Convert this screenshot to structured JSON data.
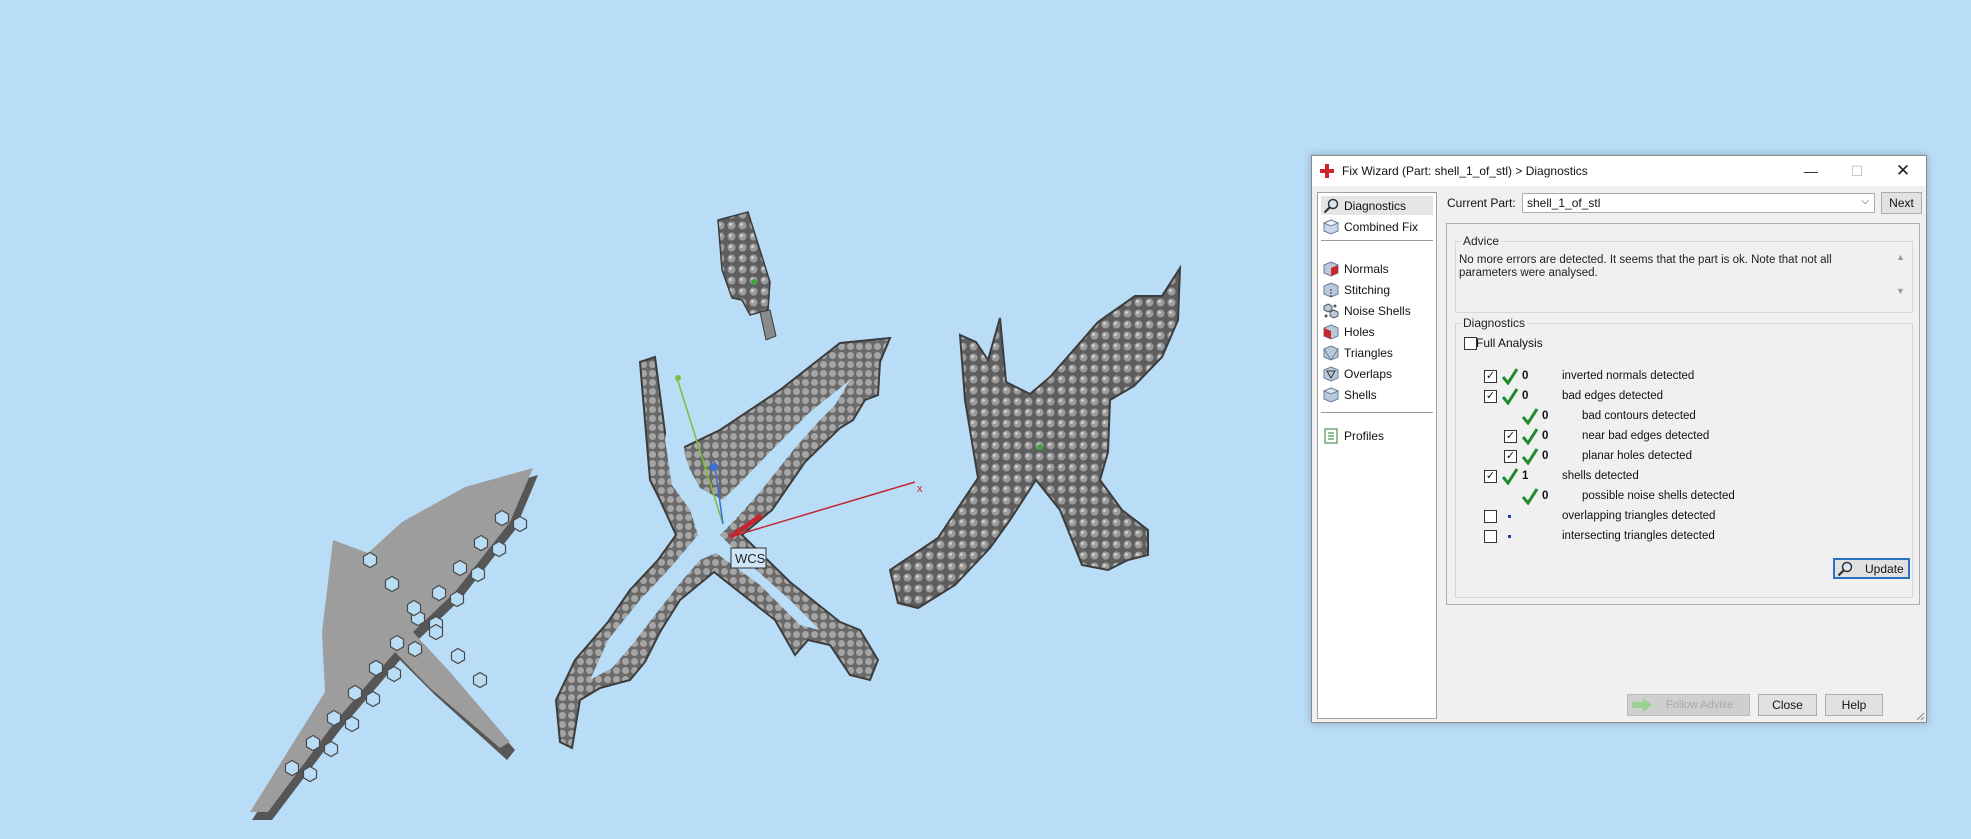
{
  "viewport": {
    "background": "#b9ddf7",
    "wcs_label": "WCS",
    "x_axis_label": "x"
  },
  "dialog": {
    "title": "Fix Wizard (Part: shell_1_of_stl) > Diagnostics",
    "title_icon": "red-cross-icon",
    "window_controls": {
      "minimize": "—",
      "maximize": "☐",
      "close": "✕"
    },
    "sidebar": {
      "top_items": [
        {
          "label": "Diagnostics",
          "icon": "magnifier-icon",
          "active": true
        },
        {
          "label": "Combined Fix",
          "icon": "cube-icon",
          "active": false
        }
      ],
      "fix_items": [
        {
          "label": "Normals",
          "icon": "normals-cube-icon"
        },
        {
          "label": "Stitching",
          "icon": "stitching-cube-icon"
        },
        {
          "label": "Noise Shells",
          "icon": "noise-shells-icon"
        },
        {
          "label": "Holes",
          "icon": "holes-cube-icon"
        },
        {
          "label": "Triangles",
          "icon": "triangles-cube-icon"
        },
        {
          "label": "Overlaps",
          "icon": "overlaps-cube-icon"
        },
        {
          "label": "Shells",
          "icon": "shells-cube-icon"
        }
      ],
      "bottom_items": [
        {
          "label": "Profiles",
          "icon": "profiles-document-icon"
        }
      ]
    },
    "current_part": {
      "label": "Current Part:",
      "value": "shell_1_of_stl",
      "next_label": "Next"
    },
    "advice": {
      "title": "Advice",
      "text": "No more errors are detected. It seems that the part is ok. Note that not all parameters were analysed."
    },
    "diagnostics": {
      "title": "Diagnostics",
      "full_analysis_label": "Full Analysis",
      "full_analysis_checked": false,
      "rows": [
        {
          "checkbox": true,
          "checked": true,
          "status": "ok",
          "count": "0",
          "desc": "inverted normals detected",
          "indent": 0
        },
        {
          "checkbox": true,
          "checked": true,
          "status": "ok",
          "count": "0",
          "desc": "bad edges detected",
          "indent": 0
        },
        {
          "checkbox": false,
          "checked": false,
          "status": "ok",
          "count": "0",
          "desc": "bad contours detected",
          "indent": 1
        },
        {
          "checkbox": true,
          "checked": true,
          "status": "ok",
          "count": "0",
          "desc": "near bad edges detected",
          "indent": 1
        },
        {
          "checkbox": true,
          "checked": true,
          "status": "ok",
          "count": "0",
          "desc": "planar holes detected",
          "indent": 1
        },
        {
          "checkbox": true,
          "checked": true,
          "status": "ok",
          "count": "1",
          "desc": "shells detected",
          "indent": 0
        },
        {
          "checkbox": false,
          "checked": false,
          "status": "ok",
          "count": "0",
          "desc": "possible noise shells detected",
          "indent": 1
        },
        {
          "checkbox": true,
          "checked": false,
          "status": "none",
          "count": "",
          "desc": "overlapping triangles detected",
          "indent": 0
        },
        {
          "checkbox": true,
          "checked": false,
          "status": "none",
          "count": "",
          "desc": "intersecting triangles detected",
          "indent": 0
        }
      ],
      "update_label": "Update"
    },
    "buttons": {
      "follow_advise": "Follow Advise",
      "close": "Close",
      "help": "Help"
    },
    "colors": {
      "accent": "#2c6fc4",
      "check_green": "#1f8a2e"
    }
  }
}
